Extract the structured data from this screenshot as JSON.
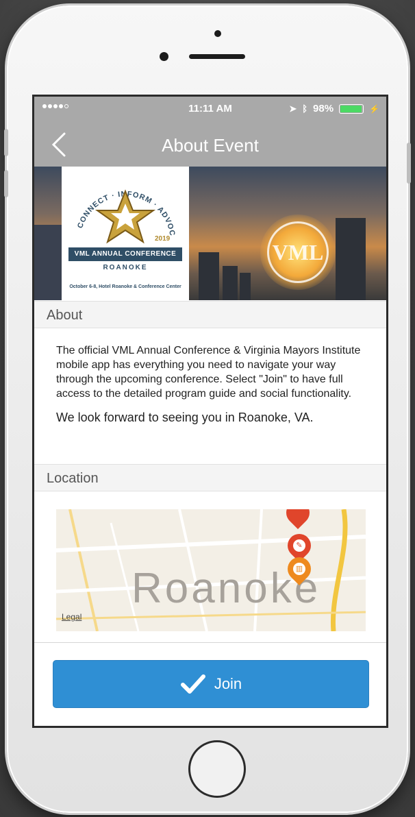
{
  "status_bar": {
    "time": "11:11 AM",
    "battery": "98%",
    "battery_level": 0.98
  },
  "nav": {
    "title": "About Event",
    "back_icon": "chevron-left-icon"
  },
  "banner": {
    "logo_arc_text": "CONNECT · INFORM · ADVOCATE",
    "logo_year": "2019",
    "logo_ribbon": "VML ANNUAL CONFERENCE",
    "logo_city": "ROANOKE",
    "logo_subtitle": "October 6-8, Hotel Roanoke & Conference Center",
    "badge_text": "VML"
  },
  "about": {
    "header": "About",
    "paragraph1": "The official VML Annual Conference & Virginia Mayors Institute mobile app has everything you need to navigate your way through the upcoming conference. Select \"Join\" to have full access to the detailed program guide and social functionality.",
    "paragraph2": "We look forward to seeing you in Roanoke, VA."
  },
  "location": {
    "header": "Location",
    "map_city": "Roanoke",
    "legal": "Legal"
  },
  "join": {
    "label": "Join",
    "icon": "checkmark-icon"
  },
  "colors": {
    "navbar": "#a9a9a9",
    "join_button": "#2f8fd4",
    "pin_red": "#e0452b",
    "pin_orange": "#ee8a1e"
  }
}
